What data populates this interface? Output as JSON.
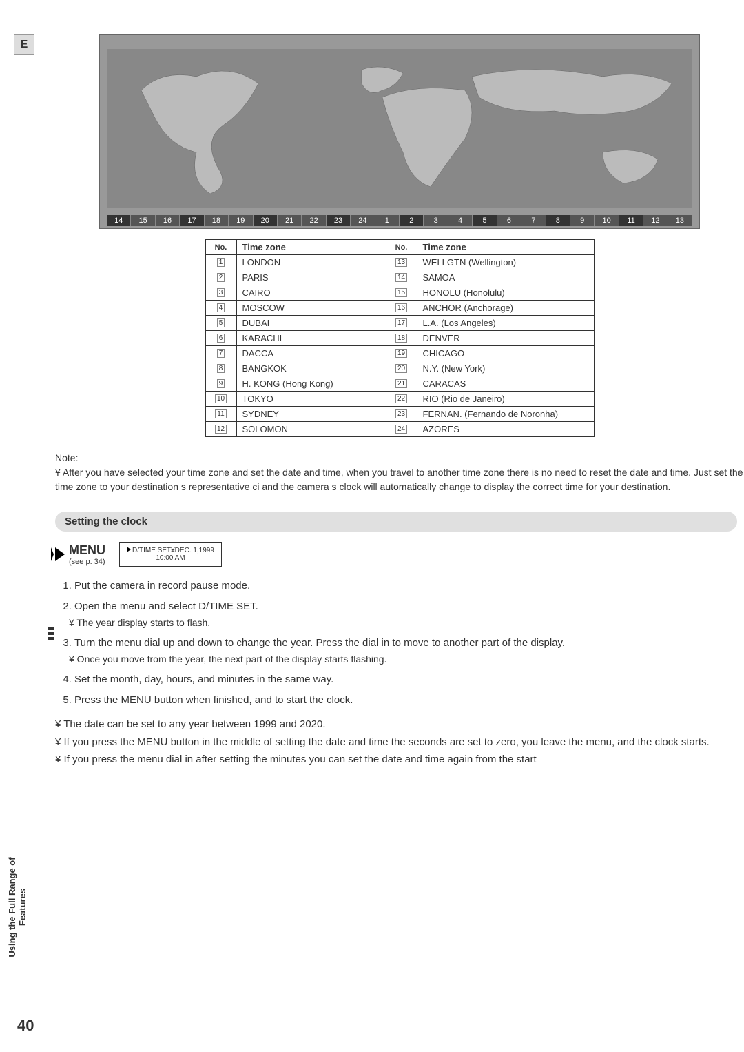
{
  "lang_badge": "E",
  "timezone_bar": [
    "14",
    "15",
    "16",
    "17",
    "18",
    "19",
    "20",
    "21",
    "22",
    "23",
    "24",
    "1",
    "2",
    "3",
    "4",
    "5",
    "6",
    "7",
    "8",
    "9",
    "10",
    "11",
    "12",
    "13"
  ],
  "table": {
    "header_no": "No.",
    "header_tz": "Time zone",
    "rows_left": [
      {
        "n": "1",
        "name": "LONDON"
      },
      {
        "n": "2",
        "name": "PARIS"
      },
      {
        "n": "3",
        "name": "CAIRO"
      },
      {
        "n": "4",
        "name": "MOSCOW"
      },
      {
        "n": "5",
        "name": "DUBAI"
      },
      {
        "n": "6",
        "name": "KARACHI"
      },
      {
        "n": "7",
        "name": "DACCA"
      },
      {
        "n": "8",
        "name": "BANGKOK"
      },
      {
        "n": "9",
        "name": "H. KONG (Hong Kong)"
      },
      {
        "n": "10",
        "name": "TOKYO"
      },
      {
        "n": "11",
        "name": "SYDNEY"
      },
      {
        "n": "12",
        "name": "SOLOMON"
      }
    ],
    "rows_right": [
      {
        "n": "13",
        "name": "WELLGTN (Wellington)"
      },
      {
        "n": "14",
        "name": "SAMOA"
      },
      {
        "n": "15",
        "name": "HONOLU (Honolulu)"
      },
      {
        "n": "16",
        "name": "ANCHOR (Anchorage)"
      },
      {
        "n": "17",
        "name": "L.A. (Los Angeles)"
      },
      {
        "n": "18",
        "name": "DENVER"
      },
      {
        "n": "19",
        "name": "CHICAGO"
      },
      {
        "n": "20",
        "name": "N.Y. (New York)"
      },
      {
        "n": "21",
        "name": "CARACAS"
      },
      {
        "n": "22",
        "name": "RIO (Rio de Janeiro)"
      },
      {
        "n": "23",
        "name": "FERNAN. (Fernando de Noronha)"
      },
      {
        "n": "24",
        "name": "AZORES"
      }
    ]
  },
  "note_label": "Note:",
  "note_text": "¥ After you have selected your time zone and set the date and time, when you travel to another time zone there is no need to reset the date and time. Just set the time zone to your destination s representative ci and the camera s clock will automatically change to display the correct time for your destination.",
  "sidebar_text": "Using the Full Range of Features",
  "section_title": "Setting the clock",
  "menu": {
    "label": "MENU",
    "sub": "(see p. 34)"
  },
  "lcd": {
    "line1": "D/TIME SET¥DEC. 1,1999",
    "line2": "10:00 AM"
  },
  "steps": {
    "s1": "Put the camera in record pause mode.",
    "s2": "Open the menu and select D/TIME SET.",
    "s2sub": "¥ The year display starts to flash.",
    "s3": "Turn the menu dial up and down to change the year. Press the dial in to move to another part of the display.",
    "s3sub": "¥ Once you move from the year, the next part of the display starts flashing.",
    "s4": "Set the month, day, hours, and minutes in the same way.",
    "s5": "Press the MENU button when finished, and to start the clock."
  },
  "bottom_notes": {
    "n1": "¥ The date can be set to any year between 1999 and 2020.",
    "n2": "¥ If you press the MENU button in the middle of setting the date and time the seconds are set to zero, you leave the menu, and the clock starts.",
    "n3": "¥ If you press the menu dial in after setting the minutes you can set the date and time again from the start"
  },
  "page_number": "40"
}
